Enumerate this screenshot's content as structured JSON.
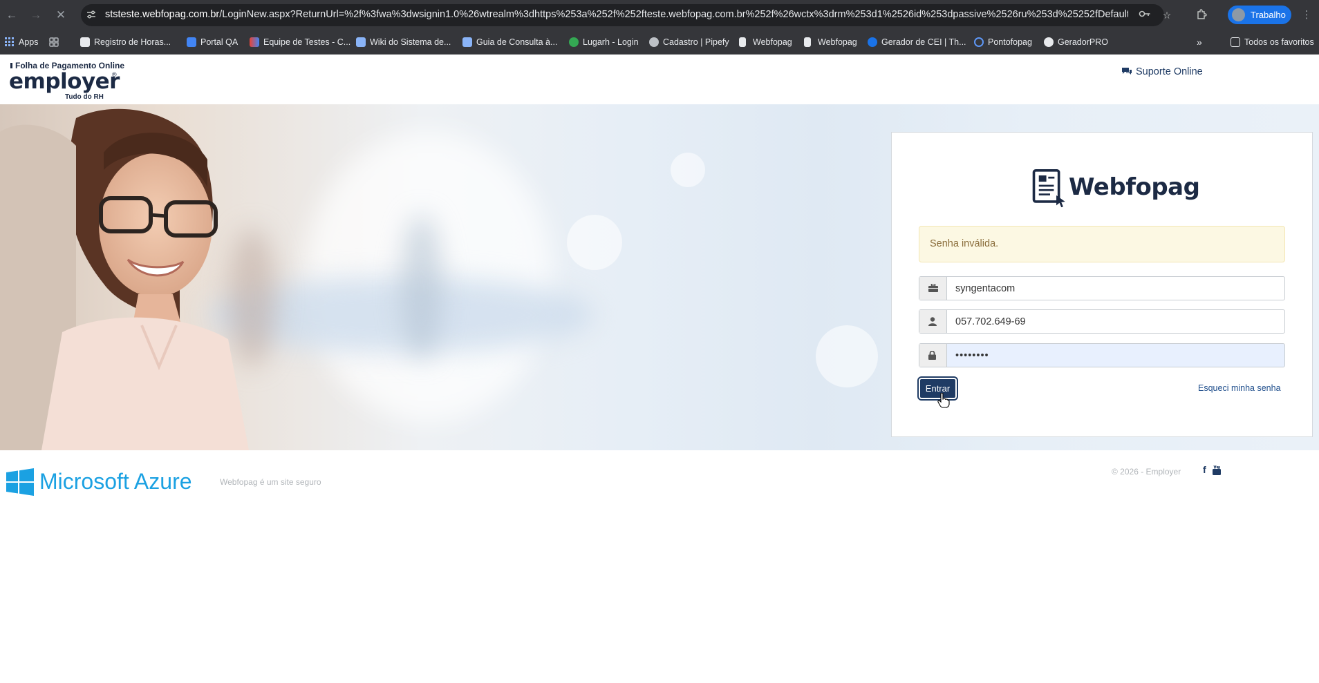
{
  "browser": {
    "url_domain": "ststeste.webfopag.com.br",
    "url_path": "/LoginNew.aspx?ReturnUrl=%2f%3fwa%3dwsignin1.0%26wtrealm%3dhttps%253a%252f%252fteste.webfopag.com.br%252f%26wctx%3drm%253d1%2526id%253dpassive%2526ru%253d%25252fDefault.aspx%252...",
    "profile_label": "Trabalho",
    "bookmarks": [
      {
        "label": "Apps",
        "color": "#8ab4f8"
      },
      {
        "label": "",
        "color": "#9aa0a6"
      },
      {
        "label": "Registro de Horas...",
        "color": "#e8eaed"
      },
      {
        "label": "Portal QA",
        "color": "#4285f4"
      },
      {
        "label": "Equipe de Testes - C...",
        "color": "#ea4335"
      },
      {
        "label": "Wiki do Sistema de...",
        "color": "#8ab4f8"
      },
      {
        "label": "Guia de Consulta à...",
        "color": "#8ab4f8"
      },
      {
        "label": "Lugarh - Login",
        "color": "#34a853"
      },
      {
        "label": "Cadastro | Pipefy",
        "color": "#bdc1c6"
      },
      {
        "label": "Webfopag",
        "color": "#e8eaed"
      },
      {
        "label": "Webfopag",
        "color": "#e8eaed"
      },
      {
        "label": "Gerador de CEI | Th...",
        "color": "#1a73e8"
      },
      {
        "label": "Pontofopag",
        "color": "#5e97f6"
      },
      {
        "label": "GeradorPRO",
        "color": "#e8eaed"
      }
    ],
    "all_bookmarks_label": "Todos os favoritos"
  },
  "header": {
    "logo_subtitle": "Folha de Pagamento Online",
    "logo_name": "employer",
    "logo_reg": "®",
    "logo_tagline": "Tudo do RH",
    "support_label": "Suporte Online"
  },
  "login": {
    "brand": "Webfopag",
    "alert_message": "Senha inválida.",
    "company_value": "syngentacom",
    "user_value": "057.702.649-69",
    "password_value": "••••••••",
    "submit_label": "Entrar",
    "forgot_label": "Esqueci minha senha"
  },
  "footer": {
    "azure_label": "Microsoft Azure",
    "secure_text": "Webfopag é um site seguro",
    "copyright": "© 2026 - Employer",
    "social": [
      "facebook-icon",
      "youtube-icon"
    ]
  },
  "colors": {
    "brand_navy": "#1c2a44",
    "button": "#1f3b64",
    "alert_bg": "#fcf8e3",
    "azure": "#1ba1e2"
  }
}
